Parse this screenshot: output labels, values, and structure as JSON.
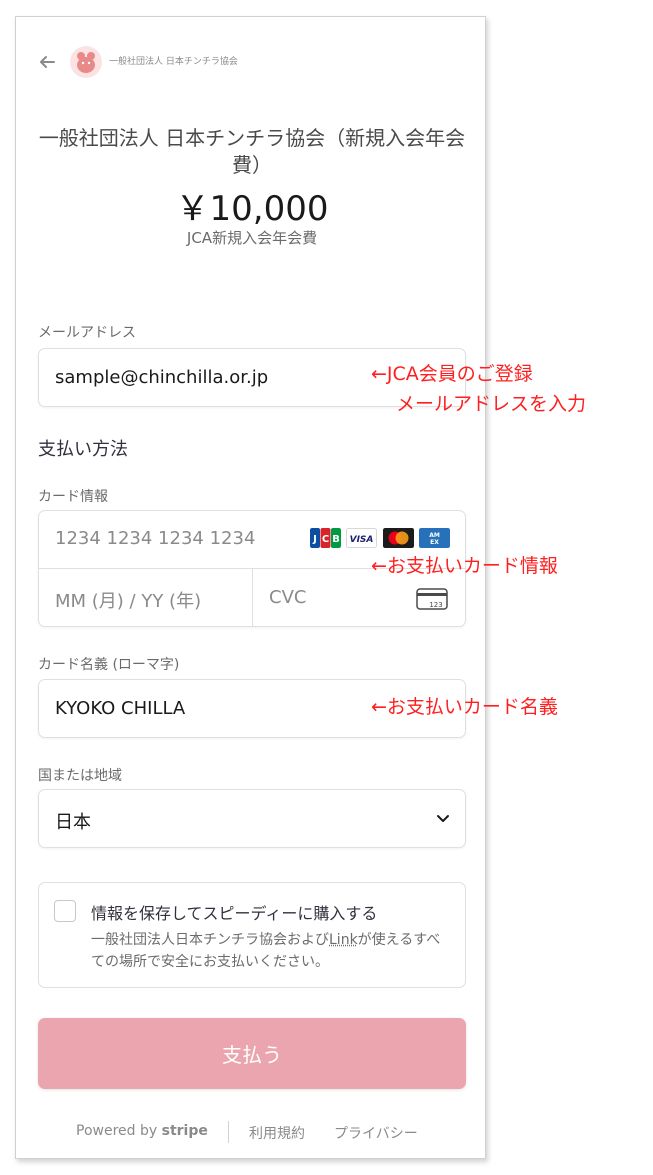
{
  "header": {
    "merchant_name": "一般社団法人 日本チンチラ協会"
  },
  "product": {
    "name": "一般社団法人 日本チンチラ協会（新規入会年会費）",
    "price": "￥10,000",
    "description": "JCA新規入会年会費"
  },
  "email": {
    "label": "メールアドレス",
    "value": "sample@chinchilla.or.jp"
  },
  "payment": {
    "section_title": "支払い方法",
    "card_label": "カード情報",
    "card_number_placeholder": "1234 1234 1234 1234",
    "expiry_placeholder": "MM (月) / YY (年)",
    "cvc_placeholder": "CVC",
    "brands": [
      "JCB",
      "VISA",
      "Mastercard",
      "AMEX"
    ]
  },
  "cardholder": {
    "label": "カード名義 (ローマ字)",
    "value": "KYOKO CHILLA"
  },
  "country": {
    "label": "国または地域",
    "value": "日本"
  },
  "save_info": {
    "title": "情報を保存してスピーディーに購入する",
    "desc_before": "一般社団法人日本チンチラ協会および",
    "link": "Link",
    "desc_after": "が使えるすべての場所で安全にお支払いください。"
  },
  "pay_button": "支払う",
  "footer": {
    "powered_by": "Powered by",
    "stripe": "stripe",
    "terms": "利用規約",
    "privacy": "プライバシー"
  },
  "annotations": {
    "email_line1": "←JCA会員のご登録",
    "email_line2": "メールアドレスを入力",
    "card": "←お支払いカード情報",
    "name": "←お支払いカード名義"
  },
  "colors": {
    "pay_button": "#eaa5ae",
    "annotation": "#ff1f1f"
  }
}
